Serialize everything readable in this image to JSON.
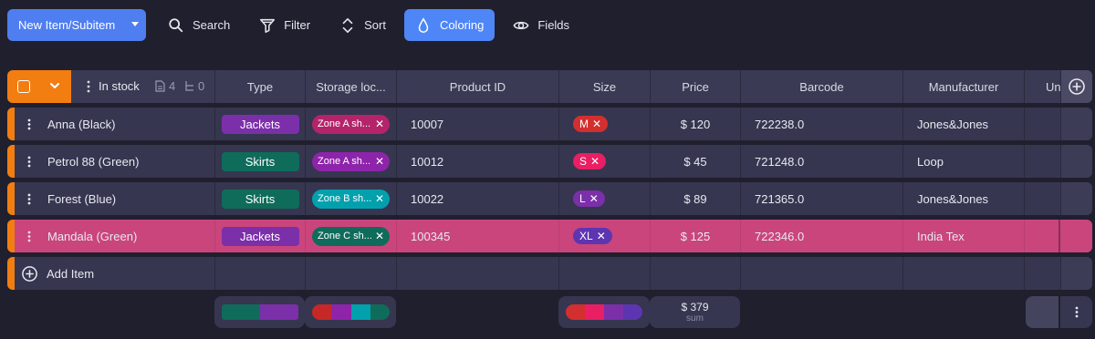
{
  "toolbar": {
    "new_label": "New Item/Subitem",
    "search_label": "Search",
    "filter_label": "Filter",
    "sort_label": "Sort",
    "coloring_label": "Coloring",
    "fields_label": "Fields"
  },
  "header": {
    "group_label": "In stock",
    "docs_count": "4",
    "subitems_count": "0",
    "columns": {
      "type": "Type",
      "storage": "Storage loc...",
      "product_id": "Product ID",
      "size": "Size",
      "price": "Price",
      "barcode": "Barcode",
      "manufacturer": "Manufacturer",
      "un": "Un"
    }
  },
  "rows": [
    {
      "name": "Anna (Black)",
      "type": "Jackets",
      "storage": "Zone A sh...",
      "product_id": "10007",
      "size": "M",
      "price": "$ 120",
      "barcode": "722238.0",
      "manufacturer": "Jones&Jones"
    },
    {
      "name": "Petrol 88 (Green)",
      "type": "Skirts",
      "storage": "Zone A sh...",
      "product_id": "10012",
      "size": "S",
      "price": "$ 45",
      "barcode": "721248.0",
      "manufacturer": "Loop"
    },
    {
      "name": "Forest (Blue)",
      "type": "Skirts",
      "storage": "Zone B sh...",
      "product_id": "10022",
      "size": "L",
      "price": "$ 89",
      "barcode": "721365.0",
      "manufacturer": "Jones&Jones"
    },
    {
      "name": "Mandala (Green)",
      "type": "Jackets",
      "storage": "Zone C sh...",
      "product_id": "100345",
      "size": "XL",
      "price": "$ 125",
      "barcode": "722346.0",
      "manufacturer": "India Tex"
    }
  ],
  "add_item_label": "Add Item",
  "summary": {
    "price_total": "$ 379",
    "price_caption": "sum"
  },
  "colors": {
    "accent": "#f27d11",
    "primary": "#4f7ef0",
    "jackets": "#7b2fa8",
    "skirts": "#0f6b5a",
    "zone_a": "#b3246b",
    "zone_a_2": "#8e24aa",
    "zone_b": "#00a1ad",
    "zone_c": "#0f6b5a",
    "size_m": "#d32f2f",
    "size_s": "#e91e63",
    "size_l": "#7b2fa8",
    "size_xl": "#5e35b1",
    "highlight_row": "#c9457c"
  }
}
